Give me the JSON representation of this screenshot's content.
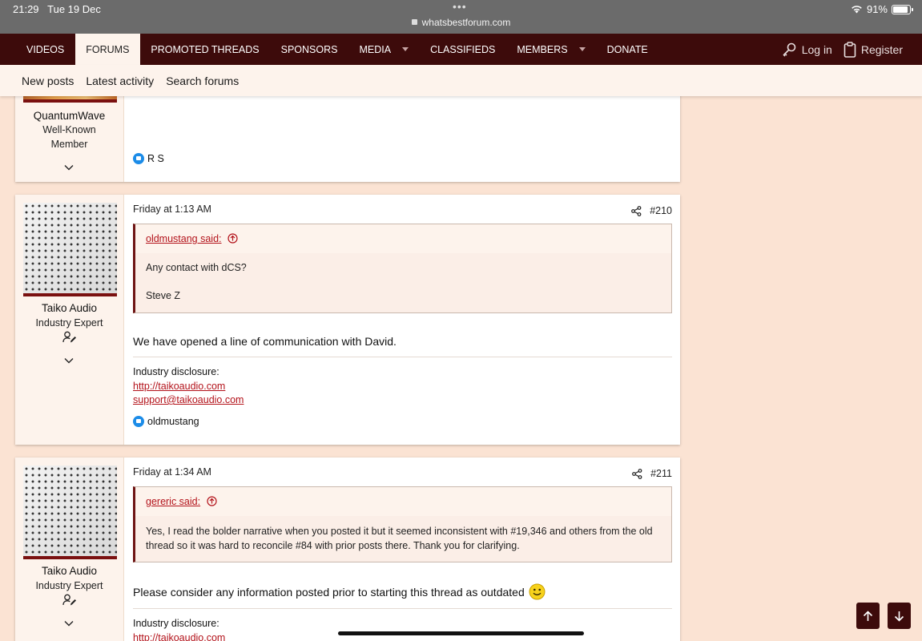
{
  "status": {
    "time": "21:29",
    "date": "Tue 19 Dec",
    "url": "whatsbestforum.com",
    "battery": "91%",
    "battery_level": 0.91
  },
  "nav": {
    "tabs": [
      {
        "label": "VIDEOS",
        "dropdown": false
      },
      {
        "label": "FORUMS",
        "dropdown": false,
        "active": true
      },
      {
        "label": "PROMOTED THREADS",
        "dropdown": false
      },
      {
        "label": "SPONSORS",
        "dropdown": false
      },
      {
        "label": "MEDIA",
        "dropdown": true
      },
      {
        "label": "CLASSIFIEDS",
        "dropdown": false
      },
      {
        "label": "MEMBERS",
        "dropdown": true
      },
      {
        "label": "DONATE",
        "dropdown": false
      }
    ],
    "login": "Log in",
    "register": "Register"
  },
  "subnav": {
    "items": [
      "New posts",
      "Latest activity",
      "Search forums"
    ]
  },
  "post0": {
    "username": "QuantumWave",
    "title_line1": "Well-Known",
    "title_line2": "Member",
    "reaction": "R S"
  },
  "post1": {
    "username": "Taiko Audio",
    "title": "Industry Expert",
    "date": "Friday at 1:13 AM",
    "number": "#210",
    "quote_author": "oldmustang said:",
    "quote_line1": "Any contact with dCS?",
    "quote_line2": "Steve Z",
    "message": "We have opened a line of communication with David.",
    "disclosure_label": "Industry disclosure:",
    "link1": "http://taikoaudio.com",
    "link2": "support@taikoaudio.com",
    "reaction": "oldmustang"
  },
  "post2": {
    "username": "Taiko Audio",
    "title": "Industry Expert",
    "date": "Friday at 1:34 AM",
    "number": "#211",
    "quote_author": "gereric said:",
    "quote_text": "Yes, I read the bolder narrative when you posted it but it seemed inconsistent with #19,346 and others from the old thread so it was hard to reconcile #84 with prior posts there. Thank you for clarifying.",
    "message": "Please consider any information posted prior to starting this thread as outdated",
    "disclosure_label": "Industry disclosure:",
    "link1": "http://taikoaudio.com"
  },
  "icons": {
    "wifi": "wifi-icon",
    "lock": "lock-icon",
    "login": "key-icon",
    "register": "clipboard-icon",
    "share": "share-icon",
    "like": "like-icon",
    "chevron": "chevron-down-icon",
    "expert": "user-edit-icon",
    "smile": "smiley-emoji"
  },
  "colors": {
    "nav_bg": "#3d0b0b",
    "page_bg": "#fbe3d3",
    "link": "#b3121a",
    "like": "#1c8ce8"
  }
}
